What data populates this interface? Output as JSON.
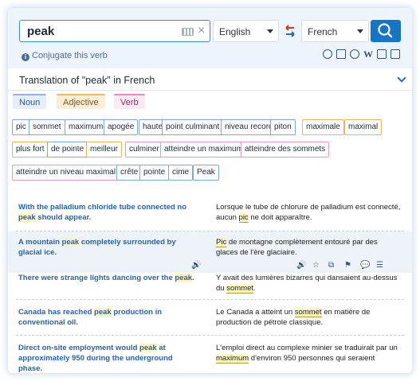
{
  "search": {
    "query": "peak",
    "clear_glyph": "×"
  },
  "languages": {
    "source": "English",
    "target": "French"
  },
  "conjugate": {
    "info_glyph": "i",
    "label": "Conjugate this verb"
  },
  "tool_icons": [
    "dollar-icon",
    "grid-icon",
    "globe-icon",
    "wikipedia-icon",
    "image-icon",
    "book-icon"
  ],
  "tool_w": "W",
  "translation": {
    "title": "Translation of \"peak\" in French"
  },
  "pos_tabs": [
    "Noun",
    "Adjective",
    "Verb"
  ],
  "chips": [
    {
      "label": "pic",
      "kind": "n"
    },
    {
      "label": "sommet",
      "kind": "n"
    },
    {
      "label": "maximum",
      "kind": "n"
    },
    {
      "label": "apogée",
      "kind": "n"
    },
    {
      "label": "haute",
      "kind": "n"
    },
    {
      "label": "point culminant",
      "kind": "n"
    },
    {
      "label": "niveau record",
      "kind": "n"
    },
    {
      "label": "piton",
      "kind": "n"
    },
    {
      "label": "maximale",
      "kind": "a"
    },
    {
      "label": "maximal",
      "kind": "a"
    },
    {
      "label": "plus fort",
      "kind": "a"
    },
    {
      "label": "de pointe",
      "kind": "n"
    },
    {
      "label": "meilleur",
      "kind": "a"
    },
    {
      "label": "culminer",
      "kind": "v"
    },
    {
      "label": "atteindre un maximum",
      "kind": "v"
    },
    {
      "label": "atteindre des sommets",
      "kind": "v"
    },
    {
      "label": "atteindre un niveau maximal",
      "kind": "v"
    },
    {
      "label": "crête",
      "kind": "n"
    },
    {
      "label": "pointe",
      "kind": "n"
    },
    {
      "label": "cime",
      "kind": "n"
    },
    {
      "label": "Peak",
      "kind": "n"
    }
  ],
  "examples": [
    {
      "src": [
        "With the palladium chloride tube connected no ",
        "peak",
        " should appear."
      ],
      "tgt": [
        "Lorsque le tube de chlorure de palladium est connecté, aucun ",
        "pic",
        " ne doit apparaître."
      ]
    },
    {
      "src": [
        "A mountain ",
        "peak",
        " completely surrounded by glacial ice."
      ],
      "tgt": [
        "",
        "Pic",
        " de montagne complètement entouré par des glaces de l'ère glaciaire."
      ]
    },
    {
      "src": [
        "There were strange lights dancing over the ",
        "peak",
        "."
      ],
      "tgt": [
        "Y avait des lumières bizarres qui dansaient au-dessus du ",
        "sommet",
        "."
      ]
    },
    {
      "src": [
        "Canada has reached ",
        "peak",
        " production in conventional oil."
      ],
      "tgt": [
        "Le Canada a atteint un ",
        "sommet",
        " en matière de production de pétrole classique."
      ]
    },
    {
      "src": [
        "Direct on-site employment would ",
        "peak",
        " at approximately 950 during the underground phase."
      ],
      "tgt": [
        "L'emploi direct au complexe minier se traduirait par un ",
        "maximum",
        " d'environ 950 personnes qui seraient"
      ]
    }
  ],
  "row_icon_glyphs": {
    "audio": "🔊",
    "star": "☆",
    "copy": "⧉",
    "flag": "⚑",
    "comment": "💬",
    "more": "☰"
  }
}
